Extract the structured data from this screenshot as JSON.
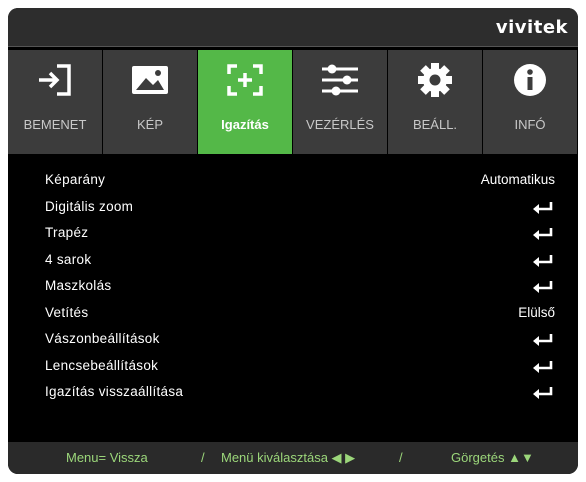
{
  "brand": "vivitek",
  "tabs": [
    {
      "label": "BEMENET",
      "icon": "input-icon",
      "active": false
    },
    {
      "label": "KÉP",
      "icon": "image-icon",
      "active": false
    },
    {
      "label": "Igazítás",
      "icon": "alignment-icon",
      "active": true
    },
    {
      "label": "VEZÉRLÉS",
      "icon": "sliders-icon",
      "active": false
    },
    {
      "label": "BEÁLL.",
      "icon": "gear-icon",
      "active": false
    },
    {
      "label": "INFÓ",
      "icon": "info-icon",
      "active": false
    }
  ],
  "menu": [
    {
      "label": "Képarány",
      "value": "Automatikus"
    },
    {
      "label": "Digitális zoom",
      "value": null,
      "icon": "enter-icon"
    },
    {
      "label": "Trapéz",
      "value": null,
      "icon": "enter-icon"
    },
    {
      "label": "4 sarok",
      "value": null,
      "icon": "enter-icon"
    },
    {
      "label": "Maszkolás",
      "value": null,
      "icon": "enter-icon"
    },
    {
      "label": "Vetítés",
      "value": "Elülső"
    },
    {
      "label": "Vászonbeállítások",
      "value": null,
      "icon": "enter-icon"
    },
    {
      "label": "Lencsebeállítások",
      "value": null,
      "icon": "enter-icon"
    },
    {
      "label": "Igazítás visszaállítása",
      "value": null,
      "icon": "enter-icon"
    }
  ],
  "footer": {
    "back": "Menu= Vissza",
    "sep1": "/",
    "select": "Menü kiválasztása ◀ ▶",
    "sep2": "/",
    "scroll": "Görgetés ▲▼"
  },
  "colors": {
    "active_tab": "#54b848",
    "tab_bg": "#3c3c3c",
    "footer_text": "#9bd67a"
  }
}
